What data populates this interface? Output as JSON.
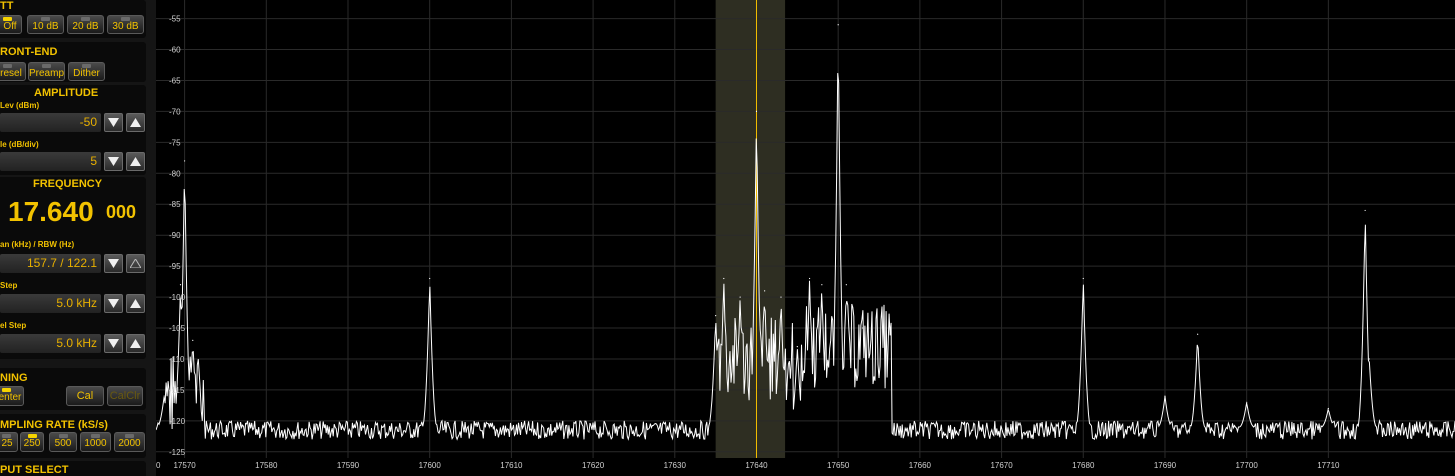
{
  "panel": {
    "att": {
      "title": "TT",
      "buttons": [
        {
          "label": "Off",
          "on": true
        },
        {
          "label": "10 dB",
          "on": false
        },
        {
          "label": "20 dB",
          "on": false
        },
        {
          "label": "30 dB",
          "on": false
        }
      ]
    },
    "front_end": {
      "title": "RONT-END",
      "buttons": [
        {
          "label": "resel",
          "on": false
        },
        {
          "label": "Preamp",
          "on": false
        },
        {
          "label": "Dither",
          "on": false
        }
      ]
    },
    "amplitude": {
      "title": "AMPLITUDE",
      "ref_label": "Lev (dBm)",
      "ref_value": "-50",
      "scale_label": "le (dB/div)",
      "scale_value": "5"
    },
    "frequency": {
      "title": "FREQUENCY",
      "main": "17.640",
      "fine": "000",
      "span_label": "an (kHz) / RBW (Hz)",
      "span_value": "157.7 / 122.1",
      "step_label": "Step",
      "step_value": "5.0 kHz",
      "chan_step_label": "el Step",
      "chan_step_value": "5.0 kHz"
    },
    "tuning": {
      "title": "NING",
      "center_label": "enter",
      "cal_label": "Cal",
      "calclr_label": "CalClr"
    },
    "sampling": {
      "title": "MPLING RATE (kS/s)",
      "buttons": [
        {
          "label": "25",
          "on": false
        },
        {
          "label": "250",
          "on": true
        },
        {
          "label": "500",
          "on": false
        },
        {
          "label": "1000",
          "on": false
        },
        {
          "label": "2000",
          "on": false
        }
      ]
    },
    "input": {
      "title": "PUT SELECT"
    }
  },
  "colors": {
    "accent": "#f2c200",
    "trace": "#ffffff",
    "marker": "#f5c000",
    "grid": "#2a2a2a",
    "highlight": "#2e2e22"
  },
  "chart_data": {
    "type": "line",
    "title": "",
    "xlabel": "",
    "ylabel": "",
    "xlim": [
      17566.5,
      17725.5
    ],
    "ylim": [
      -126,
      -52
    ],
    "x_ticks": [
      17570,
      17580,
      17590,
      17600,
      17610,
      17620,
      17630,
      17640,
      17650,
      17660,
      17670,
      17680,
      17690,
      17700,
      17710
    ],
    "x_tick_labels": [
      "17570",
      "17580",
      "17590",
      "17600",
      "17610",
      "17620",
      "17630",
      "17640",
      "17650",
      "17660",
      "17670",
      "17680",
      "17690",
      "17700",
      "17710"
    ],
    "y_ticks": [
      -55,
      -60,
      -65,
      -70,
      -75,
      -80,
      -85,
      -90,
      -95,
      -100,
      -105,
      -110,
      -115,
      -120,
      -125
    ],
    "y_tick_labels": [
      "-55",
      "-60",
      "-65",
      "-70",
      "-75",
      "-80",
      "-85",
      "-90",
      "-95",
      "-100",
      "-105",
      "-110",
      "-115",
      "-120",
      "-125"
    ],
    "noise_floor": -121,
    "marker_x": 17640,
    "highlight_band": [
      17635,
      17643.5
    ],
    "peaks": [
      {
        "x": 17570,
        "y": -78
      },
      {
        "x": 17569.5,
        "y": -98
      },
      {
        "x": 17571,
        "y": -107
      },
      {
        "x": 17567.5,
        "y": -116
      },
      {
        "x": 17600,
        "y": -97
      },
      {
        "x": 17635,
        "y": -103
      },
      {
        "x": 17636,
        "y": -97
      },
      {
        "x": 17638,
        "y": -100
      },
      {
        "x": 17640,
        "y": -70
      },
      {
        "x": 17641,
        "y": -99
      },
      {
        "x": 17643,
        "y": -100
      },
      {
        "x": 17645,
        "y": -108
      },
      {
        "x": 17646.5,
        "y": -97
      },
      {
        "x": 17648,
        "y": -98
      },
      {
        "x": 17650,
        "y": -56
      },
      {
        "x": 17651,
        "y": -98
      },
      {
        "x": 17653,
        "y": -105
      },
      {
        "x": 17655,
        "y": -113
      },
      {
        "x": 17680,
        "y": -97
      },
      {
        "x": 17690,
        "y": -116
      },
      {
        "x": 17694,
        "y": -106
      },
      {
        "x": 17700,
        "y": -117
      },
      {
        "x": 17710,
        "y": -118
      },
      {
        "x": 17714.5,
        "y": -86
      },
      {
        "x": 17715,
        "y": -110
      }
    ]
  }
}
